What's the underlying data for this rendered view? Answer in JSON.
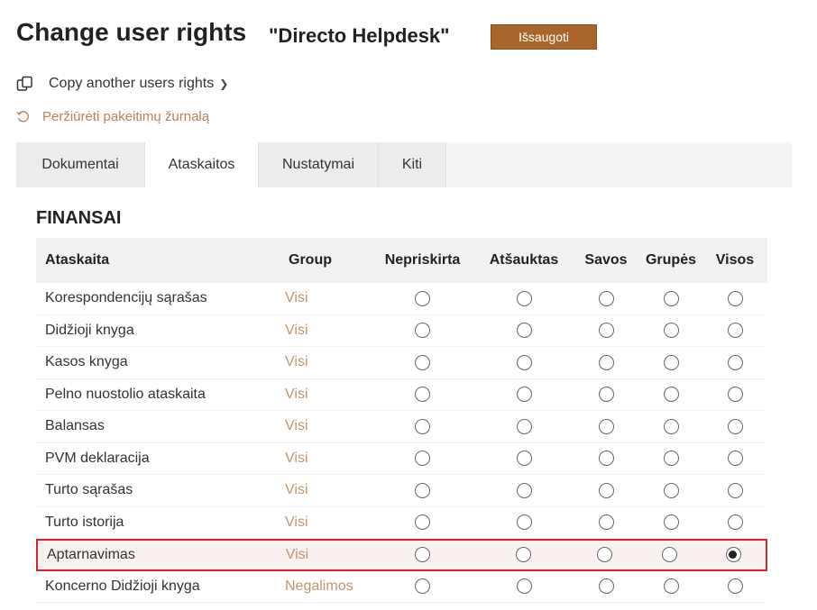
{
  "header": {
    "title": "Change user rights",
    "subtitle": "\"Directo Helpdesk\"",
    "save_label": "Išsaugoti"
  },
  "actions": {
    "copy_label": "Copy another users rights",
    "history_label": "Peržiūrėti pakeitimų žurnalą"
  },
  "tabs": [
    {
      "label": "Dokumentai",
      "active": false
    },
    {
      "label": "Ataskaitos",
      "active": true
    },
    {
      "label": "Nustatymai",
      "active": false
    },
    {
      "label": "Kiti",
      "active": false
    }
  ],
  "section": {
    "title": "FINANSAI",
    "columns": {
      "name": "Ataskaita",
      "group": "Group",
      "options": [
        "Nepriskirta",
        "Atšauktas",
        "Savos",
        "Grupės",
        "Visos"
      ]
    },
    "rows": [
      {
        "name": "Korespondencijų sąrašas",
        "group": "Visi",
        "selected": "Visos"
      },
      {
        "name": "Didžioji knyga",
        "group": "Visi",
        "selected": null
      },
      {
        "name": "Kasos knyga",
        "group": "Visi",
        "selected": null
      },
      {
        "name": "Pelno nuostolio ataskaita",
        "group": "Visi",
        "selected": null
      },
      {
        "name": "Balansas",
        "group": "Visi",
        "selected": null
      },
      {
        "name": "PVM deklaracija",
        "group": "Visi",
        "selected": null
      },
      {
        "name": "Turto sąrašas",
        "group": "Visi",
        "selected": null
      },
      {
        "name": "Turto istorija",
        "group": "Visi",
        "selected": null
      },
      {
        "name": "Aptarnavimas",
        "group": "Visi",
        "selected": "Visos",
        "highlighted": true
      },
      {
        "name": "Koncerno Didžioji knyga",
        "group": "Negalimos",
        "selected": null
      }
    ]
  },
  "colors": {
    "accent": "#a9652c",
    "group_text": "#c0956c",
    "highlight_border": "#d62434"
  }
}
